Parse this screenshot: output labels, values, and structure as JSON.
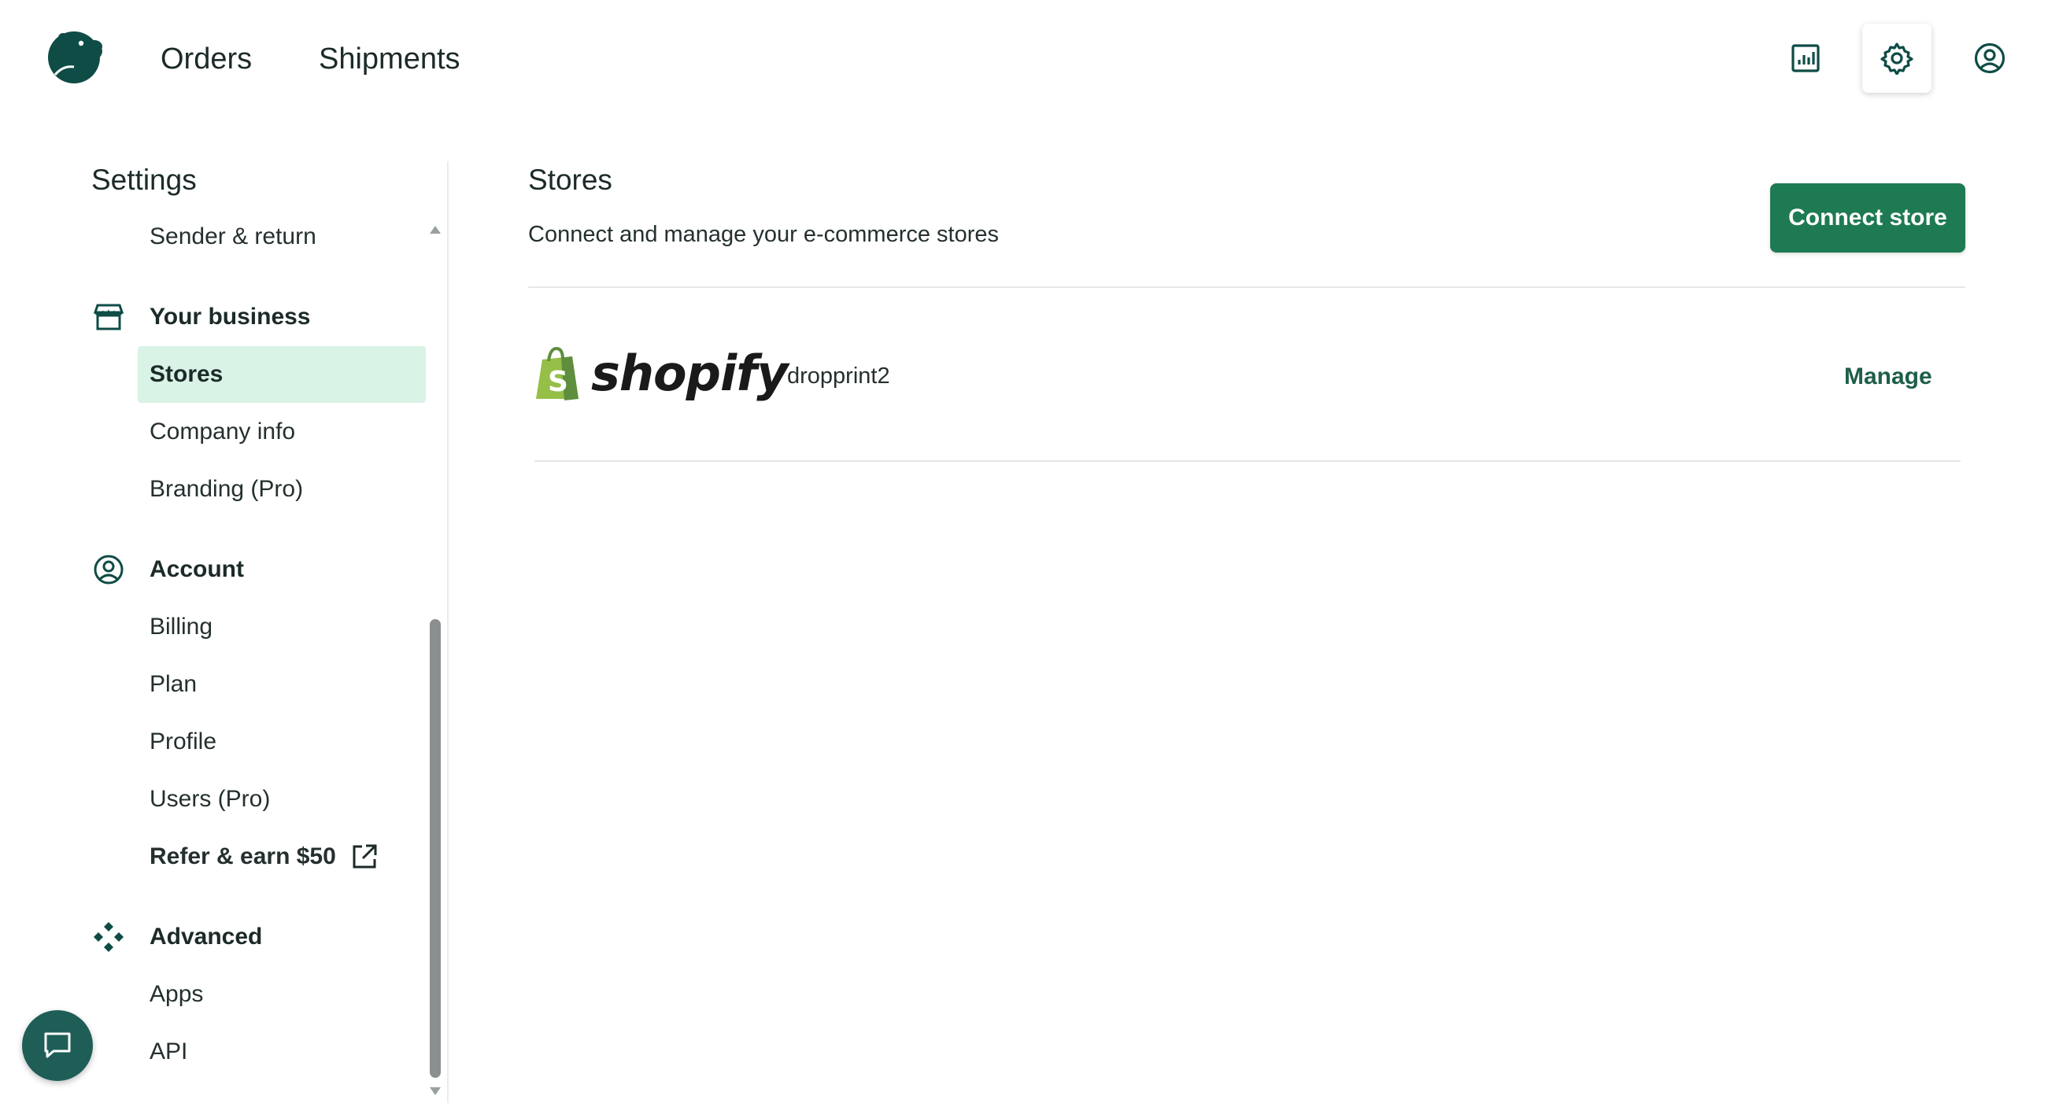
{
  "header": {
    "nav": [
      {
        "label": "Orders"
      },
      {
        "label": "Shipments"
      }
    ],
    "icons": [
      "reports-icon",
      "settings-gear-icon",
      "account-circle-icon"
    ]
  },
  "sidebar": {
    "title": "Settings",
    "items_top": [
      {
        "label": "Sender & return"
      }
    ],
    "sections": [
      {
        "label": "Your business",
        "icon": "storefront-icon",
        "items": [
          {
            "label": "Stores",
            "active": true
          },
          {
            "label": "Company info"
          },
          {
            "label": "Branding (Pro)"
          }
        ]
      },
      {
        "label": "Account",
        "icon": "user-circle-icon",
        "items": [
          {
            "label": "Billing"
          },
          {
            "label": "Plan"
          },
          {
            "label": "Profile"
          },
          {
            "label": "Users (Pro)"
          },
          {
            "label": "Refer & earn $50"
          }
        ]
      },
      {
        "label": "Advanced",
        "icon": "diamond-grid-icon",
        "items": [
          {
            "label": "Apps"
          },
          {
            "label": "API"
          }
        ]
      }
    ]
  },
  "main": {
    "title": "Stores",
    "subtitle": "Connect and manage your e-commerce stores",
    "connect_button": "Connect store",
    "stores": [
      {
        "platform": "shopify",
        "name": "dropprint2",
        "action": "Manage"
      }
    ]
  },
  "colors": {
    "brand_dark": "#0f4c46",
    "primary_button": "#1e7a52",
    "active_item_bg": "#d9f3e6",
    "link": "#1e5e4a"
  }
}
